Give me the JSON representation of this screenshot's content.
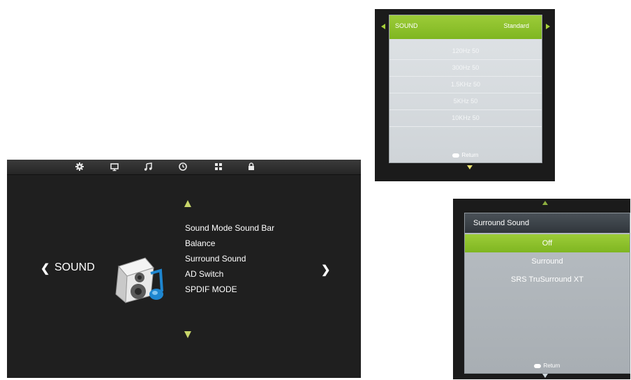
{
  "main_menu": {
    "title": "SOUND",
    "tabs": [
      {
        "icon": "gear-icon"
      },
      {
        "icon": "monitor-icon"
      },
      {
        "icon": "music-note-icon"
      },
      {
        "icon": "clock-icon"
      },
      {
        "icon": "grid-icon"
      },
      {
        "icon": "lock-icon"
      }
    ],
    "items": [
      "Sound Mode Sound Bar",
      "Balance",
      "Surround Sound",
      "AD Switch",
      "SPDIF MODE"
    ],
    "accent_color": "#c8d66a"
  },
  "sound_popup": {
    "label": "SOUND",
    "value": "Standard",
    "options": [
      "120Hz 50",
      "300Hz 50",
      "1.5KHz 50",
      "5KHz 50",
      "10KHz 50"
    ],
    "return_label": "Return",
    "highlight_color": "#8ac22a"
  },
  "surround_popup": {
    "title": "Surround Sound",
    "options": [
      "Off",
      "Surround",
      "SRS TruSurround XT"
    ],
    "selected": "Off",
    "return_label": "Return"
  }
}
